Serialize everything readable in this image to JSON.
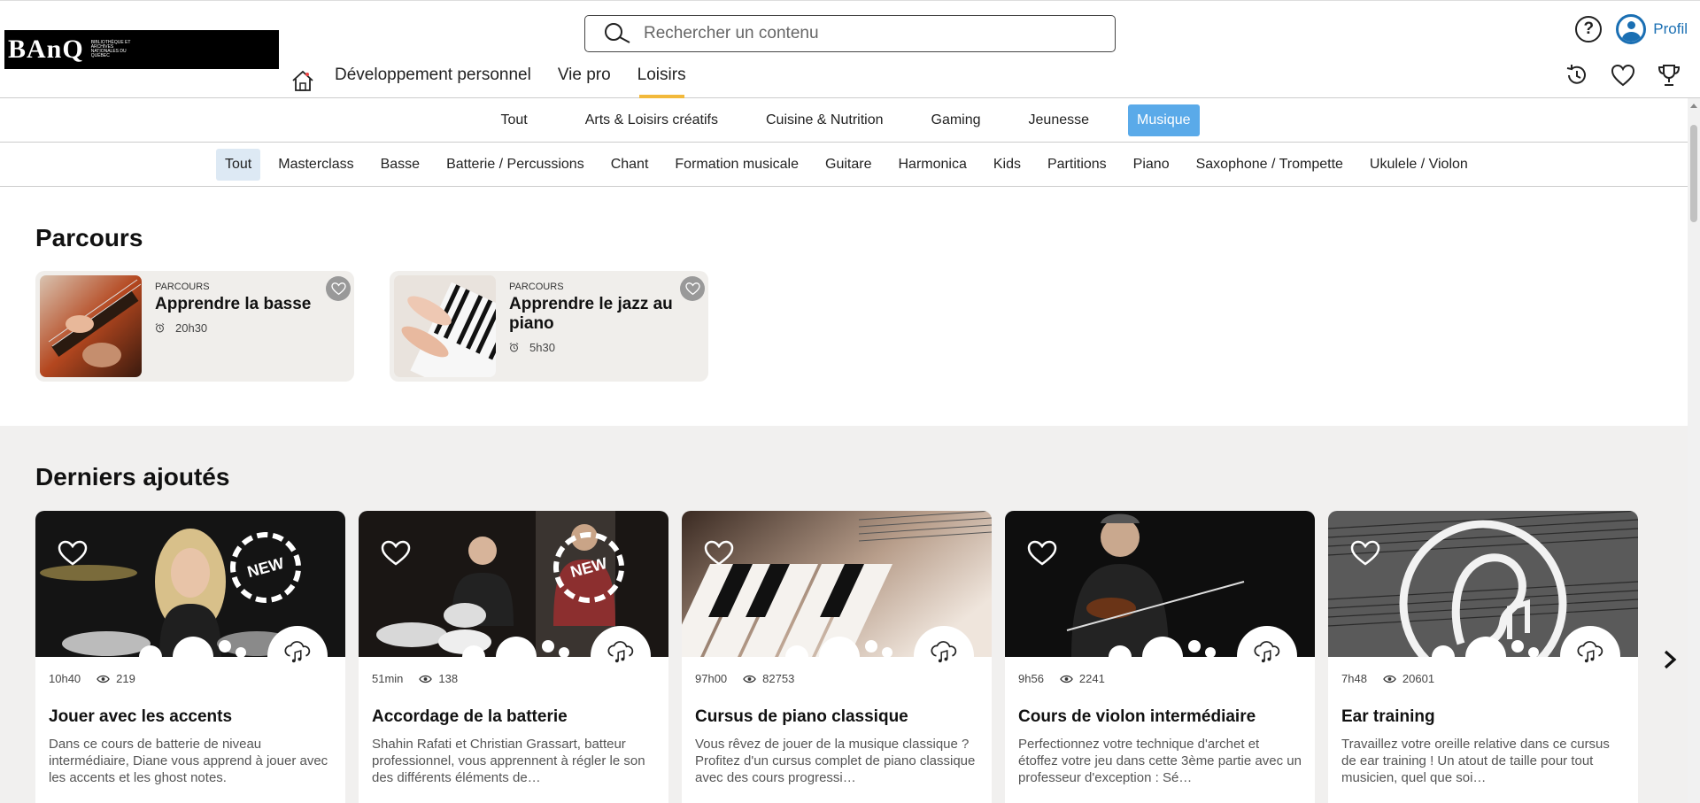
{
  "header": {
    "logo_text": "BAnQ",
    "logo_subtext": "Bibliothèque et Archives nationales du Québec",
    "search_placeholder": "Rechercher un contenu",
    "help_label": "?",
    "profile_label": "Profil"
  },
  "nav": {
    "items": [
      {
        "label": "Développement personnel"
      },
      {
        "label": "Vie pro"
      },
      {
        "label": "Loisirs"
      }
    ],
    "active": "Loisirs"
  },
  "subnav": {
    "items": [
      "Tout",
      "Arts & Loisirs créatifs",
      "Cuisine & Nutrition",
      "Gaming",
      "Jeunesse",
      "Musique"
    ],
    "active": "Musique"
  },
  "categories": {
    "items": [
      "Tout",
      "Masterclass",
      "Basse",
      "Batterie / Percussions",
      "Chant",
      "Formation musicale",
      "Guitare",
      "Harmonica",
      "Kids",
      "Partitions",
      "Piano",
      "Saxophone / Trompette",
      "Ukulele / Violon"
    ],
    "active": "Tout"
  },
  "parcours": {
    "title": "Parcours",
    "cards": [
      {
        "kicker": "PARCOURS",
        "title": "Apprendre la basse",
        "duration": "20h30"
      },
      {
        "kicker": "PARCOURS",
        "title": "Apprendre le jazz au piano",
        "duration": "5h30"
      }
    ]
  },
  "latest": {
    "title": "Derniers ajoutés",
    "cards": [
      {
        "duration": "10h40",
        "views": "219",
        "title": "Jouer avec les accents",
        "description": "Dans ce cours de batterie de niveau intermédiaire, Diane vous apprend à jouer avec les accents et les ghost notes.",
        "badge": "NEW"
      },
      {
        "duration": "51min",
        "views": "138",
        "title": "Accordage de la batterie",
        "description": "Shahin Rafati et Christian Grassart, batteur professionnel, vous apprennent à régler le son des différents éléments de…",
        "badge": "NEW"
      },
      {
        "duration": "97h00",
        "views": "82753",
        "title": "Cursus de piano classique",
        "description": "Vous rêvez de jouer de la musique classique ? Profitez d'un cursus complet de piano classique avec des cours progressi…",
        "badge": ""
      },
      {
        "duration": "9h56",
        "views": "2241",
        "title": "Cours de violon intermédiaire",
        "description": "Perfectionnez votre technique d'archet et étoffez votre jeu dans cette 3ème partie avec un professeur d'exception : Sé…",
        "badge": ""
      },
      {
        "duration": "7h48",
        "views": "20601",
        "title": "Ear training",
        "description": "Travaillez votre oreille relative dans ce cursus de ear training ! Un atout de taille pour tout musicien, quel que soi…",
        "badge": ""
      }
    ]
  },
  "colors": {
    "accent": "#5aaae9",
    "nav_underline": "#f2b93b",
    "profile": "#1a6fb3"
  }
}
